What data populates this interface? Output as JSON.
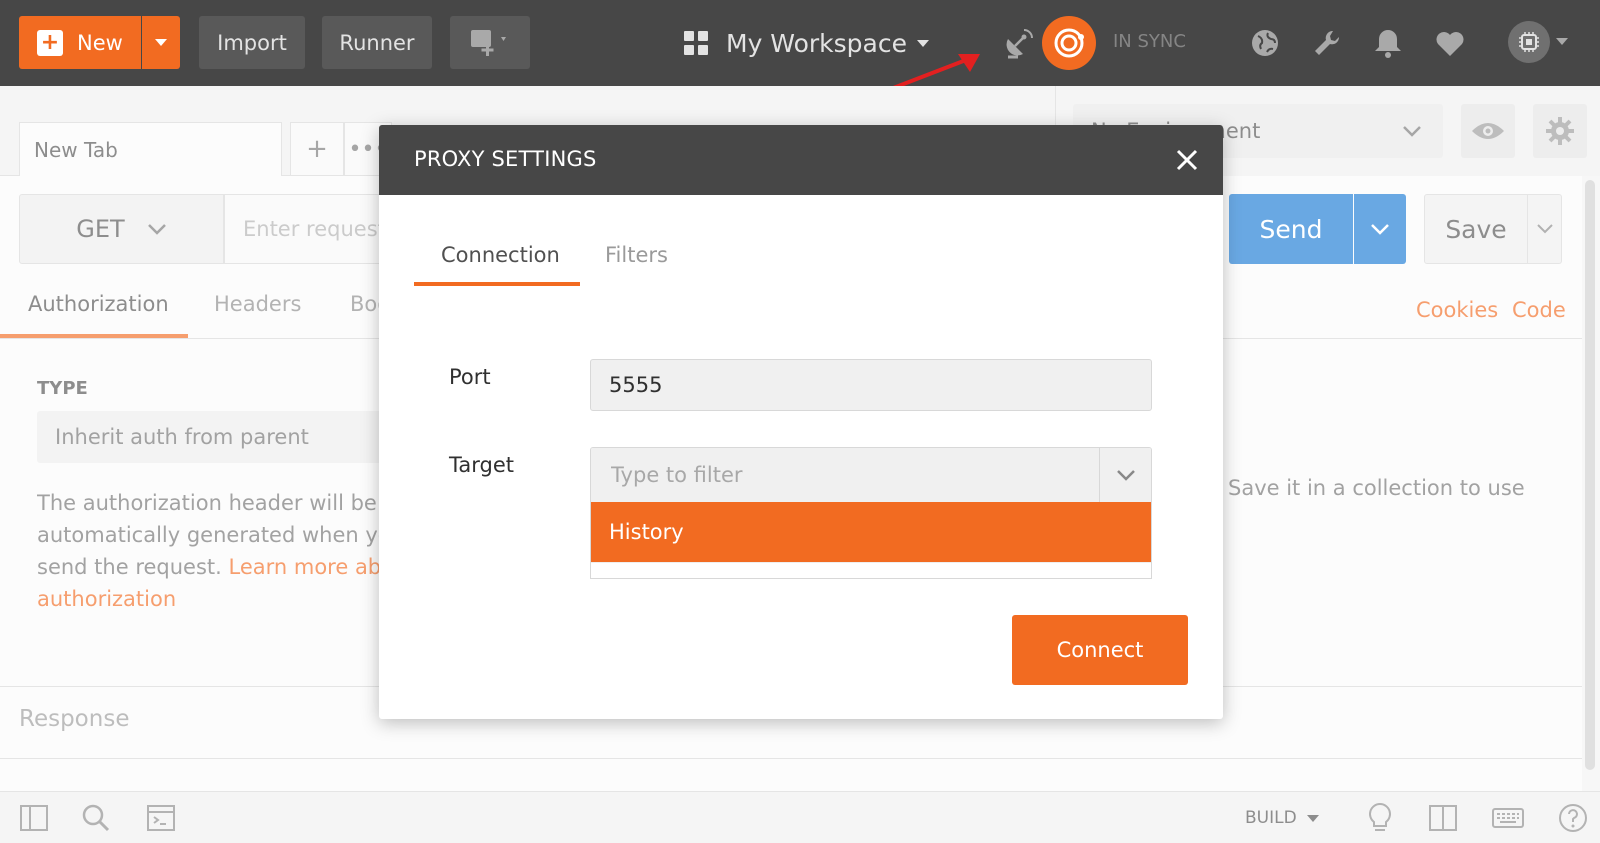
{
  "header": {
    "new_label": "New",
    "import_label": "Import",
    "runner_label": "Runner",
    "workspace_label": "My Workspace",
    "sync_status": "IN SYNC"
  },
  "tabs": [
    {
      "label": "New Tab"
    }
  ],
  "request": {
    "method": "GET",
    "url_placeholder": "Enter request URL",
    "send_label": "Send",
    "save_label": "Save"
  },
  "environment": {
    "selected": "No Environment"
  },
  "subtabs": {
    "authorization": "Authorization",
    "headers": "Headers",
    "body": "Body",
    "cookies": "Cookies",
    "code": "Code"
  },
  "auth": {
    "type_label": "TYPE",
    "type_value": "Inherit auth from parent",
    "desc_line1": "The authorization header will be",
    "desc_line2": "automatically generated when you",
    "desc_line3_prefix": "send the request. ",
    "desc_link": "Learn more about",
    "desc_link2": "authorization"
  },
  "save_hint": "Save it in a collection to use",
  "response_label": "Response",
  "footer": {
    "build_label": "BUILD"
  },
  "modal": {
    "title": "PROXY SETTINGS",
    "tabs": {
      "connection": "Connection",
      "filters": "Filters"
    },
    "port_label": "Port",
    "port_value": "5555",
    "target_label": "Target",
    "target_placeholder": "Type to filter",
    "target_options": [
      "History"
    ],
    "connect_label": "Connect"
  },
  "colors": {
    "accent": "#f26b21",
    "header_bg": "#474747",
    "send_blue": "#1a7ad4",
    "annotation_arrow": "#e32020"
  },
  "icons": {
    "new": "plus-icon",
    "new_window": "new-window-icon",
    "workspace": "grid-icon",
    "capture": "satellite-dish-icon",
    "sync": "sync-orbit-icon",
    "globe": "globe-icon",
    "settings": "wrench-icon",
    "notifications": "bell-icon",
    "favorite": "heart-icon",
    "account": "avatar-icon"
  }
}
